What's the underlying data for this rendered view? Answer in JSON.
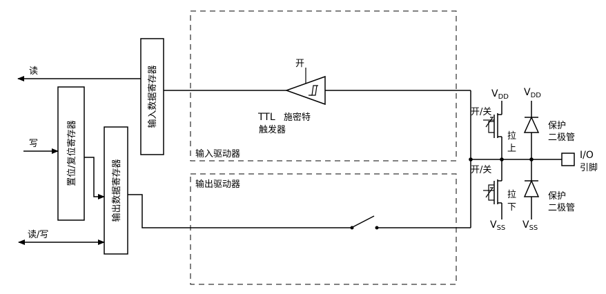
{
  "labels": {
    "read": "读",
    "write": "写",
    "read_write": "读/写",
    "set_reset_reg": "置位/复位寄存器",
    "input_data_reg": "输入数据寄存器",
    "output_data_reg": "输出数据寄存器",
    "input_driver": "输入驱动器",
    "output_driver": "输出驱动器",
    "trigger_on": "开",
    "ttl": "TTL",
    "ttl_schmitt_1": "施密特",
    "ttl_schmitt_2": "触发器",
    "on_off_up": "开/关",
    "on_off_down": "开/关",
    "pull_up_1": "拉",
    "pull_up_2": "上",
    "pull_down_1": "拉",
    "pull_down_2": "下",
    "vdd_main_1": "V",
    "vdd_sub_1": "DD",
    "vdd_main_2": "V",
    "vdd_sub_2": "DD",
    "vss_main_1": "V",
    "vss_sub_1": "SS",
    "vss_main_2": "V",
    "vss_sub_2": "SS",
    "protect_1a": "保护",
    "protect_1b": "二极管",
    "protect_2a": "保护",
    "protect_2b": "二极管",
    "io_1": "I/O",
    "io_2": "引脚"
  }
}
